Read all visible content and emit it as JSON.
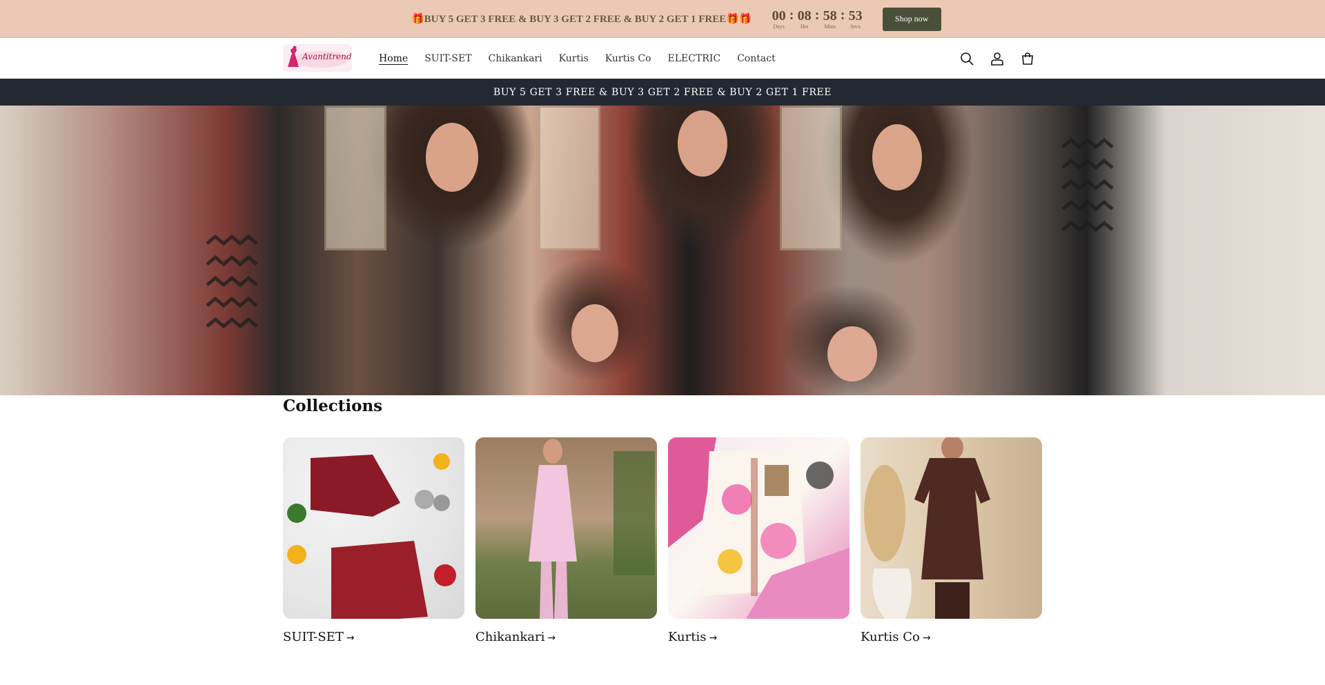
{
  "topbar": {
    "promo": "🎁BUY 5 GET 3 FREE & BUY 3 GET 2 FREE & BUY 2 GET 1 FREE🎁🎁",
    "countdown": [
      {
        "value": "00",
        "label": "Days"
      },
      {
        "value": "08",
        "label": "Hrs"
      },
      {
        "value": "58",
        "label": "Mins"
      },
      {
        "value": "53",
        "label": "Secs"
      }
    ],
    "separator": ":",
    "cta": "Shop now"
  },
  "header": {
    "logo_text": "Avantitrend",
    "nav": [
      "Home",
      "SUIT-SET",
      "Chikankari",
      "Kurtis",
      "Kurtis Co",
      "ELECTRIC",
      "Contact"
    ],
    "icons": [
      "search-icon",
      "account-icon",
      "cart-icon"
    ]
  },
  "announcement": "BUY 5 GET 3 FREE & BUY 3 GET 2 FREE & BUY 2 GET 1 FREE",
  "collections": {
    "title": "Collections",
    "items": [
      {
        "label": "SUIT-SET",
        "arrow": "→"
      },
      {
        "label": "Chikankari",
        "arrow": "→"
      },
      {
        "label": "Kurtis",
        "arrow": "→"
      },
      {
        "label": "Kurtis Co",
        "arrow": "→"
      }
    ]
  },
  "colors": {
    "topbar_bg": "#ecc9b4",
    "cta_bg": "#4a4f3a",
    "announcement_bg": "#242833"
  }
}
